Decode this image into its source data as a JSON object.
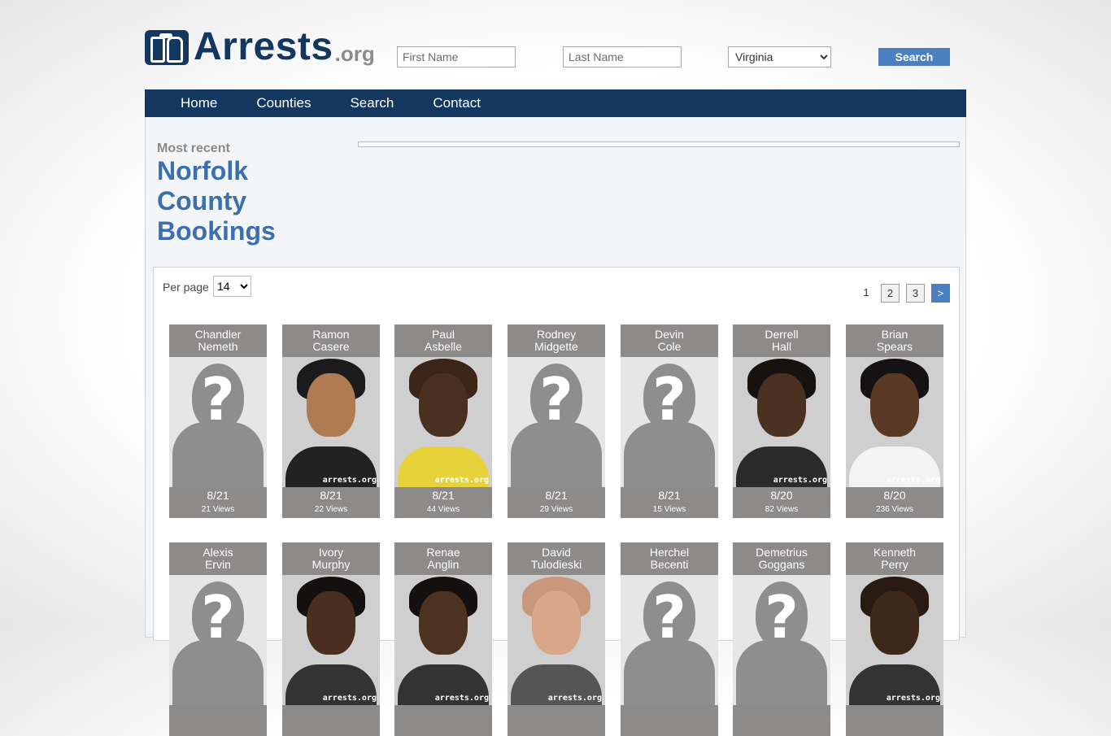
{
  "header": {
    "logo_text": "Arrests",
    "logo_suffix": ".org",
    "first_name_placeholder": "First Name",
    "last_name_placeholder": "Last Name",
    "state_selected": "Virginia",
    "search_label": "Search"
  },
  "nav": {
    "items": [
      "Home",
      "Counties",
      "Search",
      "Contact"
    ]
  },
  "main": {
    "subtitle": "Most recent",
    "title": "Norfolk County Bookings"
  },
  "results": {
    "per_page_label": "Per page",
    "per_page_value": "14",
    "pages": [
      "1",
      "2",
      "3",
      ">"
    ],
    "current_page": "1",
    "people": [
      {
        "first": "Chandler",
        "last": "Nemeth",
        "date": "8/21",
        "views": "21 Views",
        "photo": "placeholder"
      },
      {
        "first": "Ramon",
        "last": "Casere",
        "date": "8/21",
        "views": "22 Views",
        "photo": "mugshot",
        "skin": "#b07a52",
        "hair": "#1b1b1b",
        "shirt": "#222222"
      },
      {
        "first": "Paul",
        "last": "Asbelle",
        "date": "8/21",
        "views": "44 Views",
        "photo": "mugshot",
        "skin": "#4a3020",
        "hair": "#3a2518",
        "shirt": "#e8d23a"
      },
      {
        "first": "Rodney",
        "last": "Midgette",
        "date": "8/21",
        "views": "29 Views",
        "photo": "placeholder"
      },
      {
        "first": "Devin",
        "last": "Cole",
        "date": "8/21",
        "views": "15 Views",
        "photo": "placeholder"
      },
      {
        "first": "Derrell",
        "last": "Hall",
        "date": "8/20",
        "views": "82 Views",
        "photo": "mugshot",
        "skin": "#4b3121",
        "hair": "#161210",
        "shirt": "#2b2b2b"
      },
      {
        "first": "Brian",
        "last": "Spears",
        "date": "8/20",
        "views": "236 Views",
        "photo": "mugshot",
        "skin": "#5a3a26",
        "hair": "#141212",
        "shirt": "#f3f3f3"
      },
      {
        "first": "Alexis",
        "last": "Ervin",
        "date": "",
        "views": "",
        "photo": "placeholder"
      },
      {
        "first": "Ivory",
        "last": "Murphy",
        "date": "",
        "views": "",
        "photo": "mugshot",
        "skin": "#4a2f20",
        "hair": "#141010",
        "shirt": "#333333"
      },
      {
        "first": "Renae",
        "last": "Anglin",
        "date": "",
        "views": "",
        "photo": "mugshot",
        "skin": "#4d3222",
        "hair": "#141010",
        "shirt": "#333333"
      },
      {
        "first": "David",
        "last": "Tulodieski",
        "date": "",
        "views": "",
        "photo": "mugshot",
        "skin": "#d9a68a",
        "hair": "#c9987c",
        "shirt": "#555555"
      },
      {
        "first": "Herchel",
        "last": "Becenti",
        "date": "",
        "views": "",
        "photo": "placeholder"
      },
      {
        "first": "Demetrius",
        "last": "Goggans",
        "date": "",
        "views": "",
        "photo": "placeholder"
      },
      {
        "first": "Kenneth",
        "last": "Perry",
        "date": "",
        "views": "",
        "photo": "mugshot",
        "skin": "#3e281b",
        "hair": "#2a1b12",
        "shirt": "#333333"
      }
    ],
    "watermark": "arrests.org",
    "placeholder_glyph": "?"
  }
}
